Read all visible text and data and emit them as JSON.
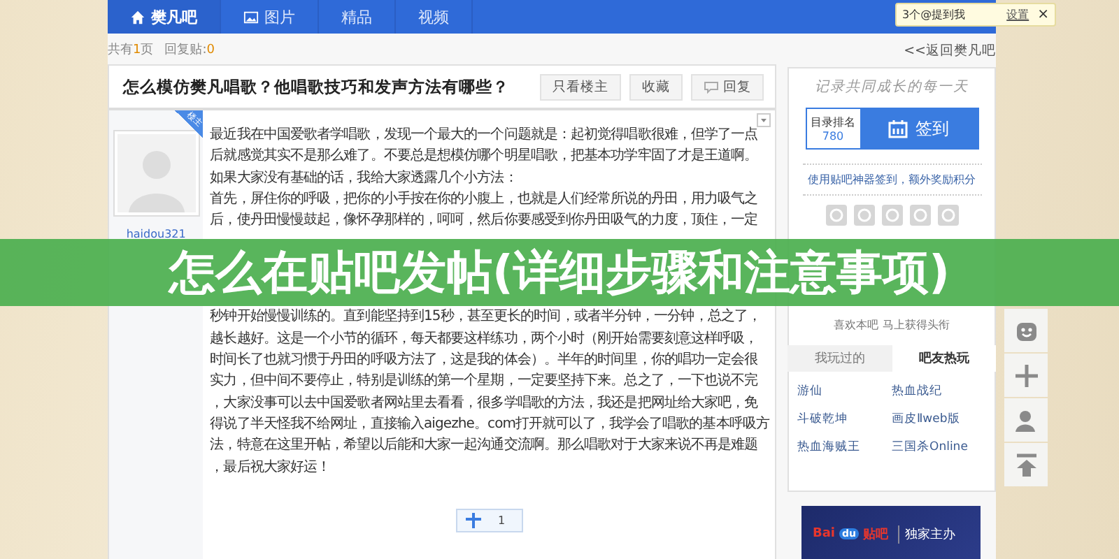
{
  "nav": {
    "items": [
      {
        "label": "樊凡吧",
        "kind": "home",
        "selected": true
      },
      {
        "label": "图片",
        "kind": "gallery",
        "selected": false
      },
      {
        "label": "精品",
        "kind": "plain",
        "selected": false
      },
      {
        "label": "视频",
        "kind": "plain",
        "selected": false
      }
    ]
  },
  "notification": {
    "text": "3个@提到我",
    "link": "设置",
    "close": "×"
  },
  "meta": [
    {
      "prefix": "共有",
      "count": "1",
      "suffix": "页"
    },
    {
      "prefix": "回复贴:",
      "count": "0"
    }
  ],
  "back_link": "<<返回樊凡吧",
  "post": {
    "title": "怎么模仿樊凡唱歌？他唱歌技巧和发声方法有哪些？",
    "buttons": [
      {
        "label": "只看楼主",
        "kind": "plain"
      },
      {
        "label": "收藏",
        "kind": "plain"
      },
      {
        "label": "回复",
        "kind": "reply"
      }
    ],
    "author": "haidou321",
    "badge": "楼主",
    "text_blocks": [
      [
        "最近我在中国爱歌者学唱歌，发现一个最大的一个问题就是：起初觉得唱歌很难，但学了一点",
        "后就感觉其实不是那么难了。不要总是想模仿哪个明星唱歌，把基本功学牢固了才是王道啊。",
        "如果大家没有基础的话，我给大家透露几个小方法：",
        "首先，屏住你的呼吸，把你的小手按在你的小腹上，也就是人们经常所说的丹田，用力吸气之",
        "后，使丹田慢慢鼓起，像怀孕那样的，呵呵，然后你要感受到你丹田吸气的力度，顶住，一定"
      ],
      [
        "秒钟开始慢慢训练的。直到能坚持到15秒，甚至更长的时间，或者半分钟，一分钟，总之了，",
        "越长越好。这是一个小节的循环，每天都要这样练功，两个小时（刚开始需要刻意这样呼吸，",
        "时间长了也就习惯于丹田的呼吸方法了，这是我的体会）。半年的时间里，你的唱功一定会很",
        "实力，但中间不要停止，特别是训练的第一个星期，一定要坚持下来。总之了，一下也说不完",
        "，大家没事可以去中国爱歌者网站里去看看，很多学唱歌的方法，我还是把网址给大家吧，免",
        "得说了半天怪我不给网址，直接输入aigezhe。com打开就可以了，我学会了唱歌的基本呼吸方",
        "法，特意在这里开帖，希望以后能和大家一起沟通交流啊。那么唱歌对于大家来说不再是难题",
        "，最后祝大家好运！"
      ]
    ],
    "like_count": "1"
  },
  "sidebar": {
    "slogan": "记录共同成长的每一天",
    "rank_label": "目录排名",
    "rank": "780",
    "signin": "签到",
    "tip": "使用贴吧神器签到，额外奖励积分",
    "title_hint": "喜欢本吧 马上获得头衔",
    "tabs": [
      {
        "label": "我玩过的",
        "selected": false
      },
      {
        "label": "吧友热玩",
        "selected": true
      }
    ],
    "games": [
      "游仙",
      "热血战纪",
      "斗破乾坤",
      "画皮Ⅱweb版",
      "热血海贼王",
      "三国杀Online"
    ],
    "ad": {
      "brand_a": "Bai",
      "brand_b": "du",
      "brand_c": "贴吧",
      "slogan": "独家主办"
    }
  },
  "banner": {
    "title": "怎么在贴吧发帖(详细步骤和注意事项)"
  }
}
